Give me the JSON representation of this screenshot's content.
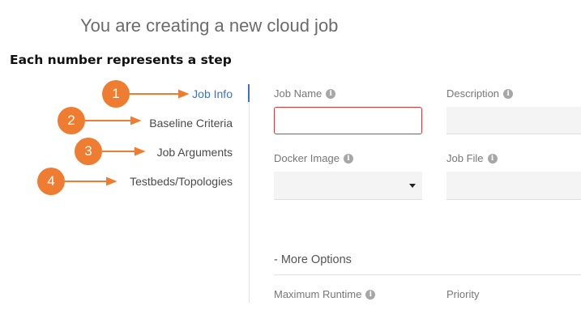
{
  "page": {
    "title": "You are creating a new cloud job",
    "step_caption": "Each number represents a step"
  },
  "steps": [
    {
      "number": "1",
      "label": "Job Info",
      "active": true
    },
    {
      "number": "2",
      "label": "Baseline Criteria",
      "active": false
    },
    {
      "number": "3",
      "label": "Job Arguments",
      "active": false
    },
    {
      "number": "4",
      "label": "Testbeds/Topologies",
      "active": false
    }
  ],
  "form": {
    "job_name": {
      "label": "Job Name",
      "value": "",
      "state": "error"
    },
    "description": {
      "label": "Description",
      "value": ""
    },
    "docker_image": {
      "label": "Docker Image",
      "selected": ""
    },
    "job_file": {
      "label": "Job File",
      "value": ""
    },
    "more_options": "- More Options",
    "maximum_runtime": {
      "label": "Maximum Runtime"
    },
    "priority": {
      "label": "Priority"
    }
  },
  "icons": {
    "info": "info-icon",
    "dropdown": "chevron-down-icon"
  },
  "colors": {
    "accent_blue": "#3b73c8",
    "step_orange": "#ee7d31",
    "error_red": "#d9393b",
    "title_gray": "#6b6b6b"
  }
}
